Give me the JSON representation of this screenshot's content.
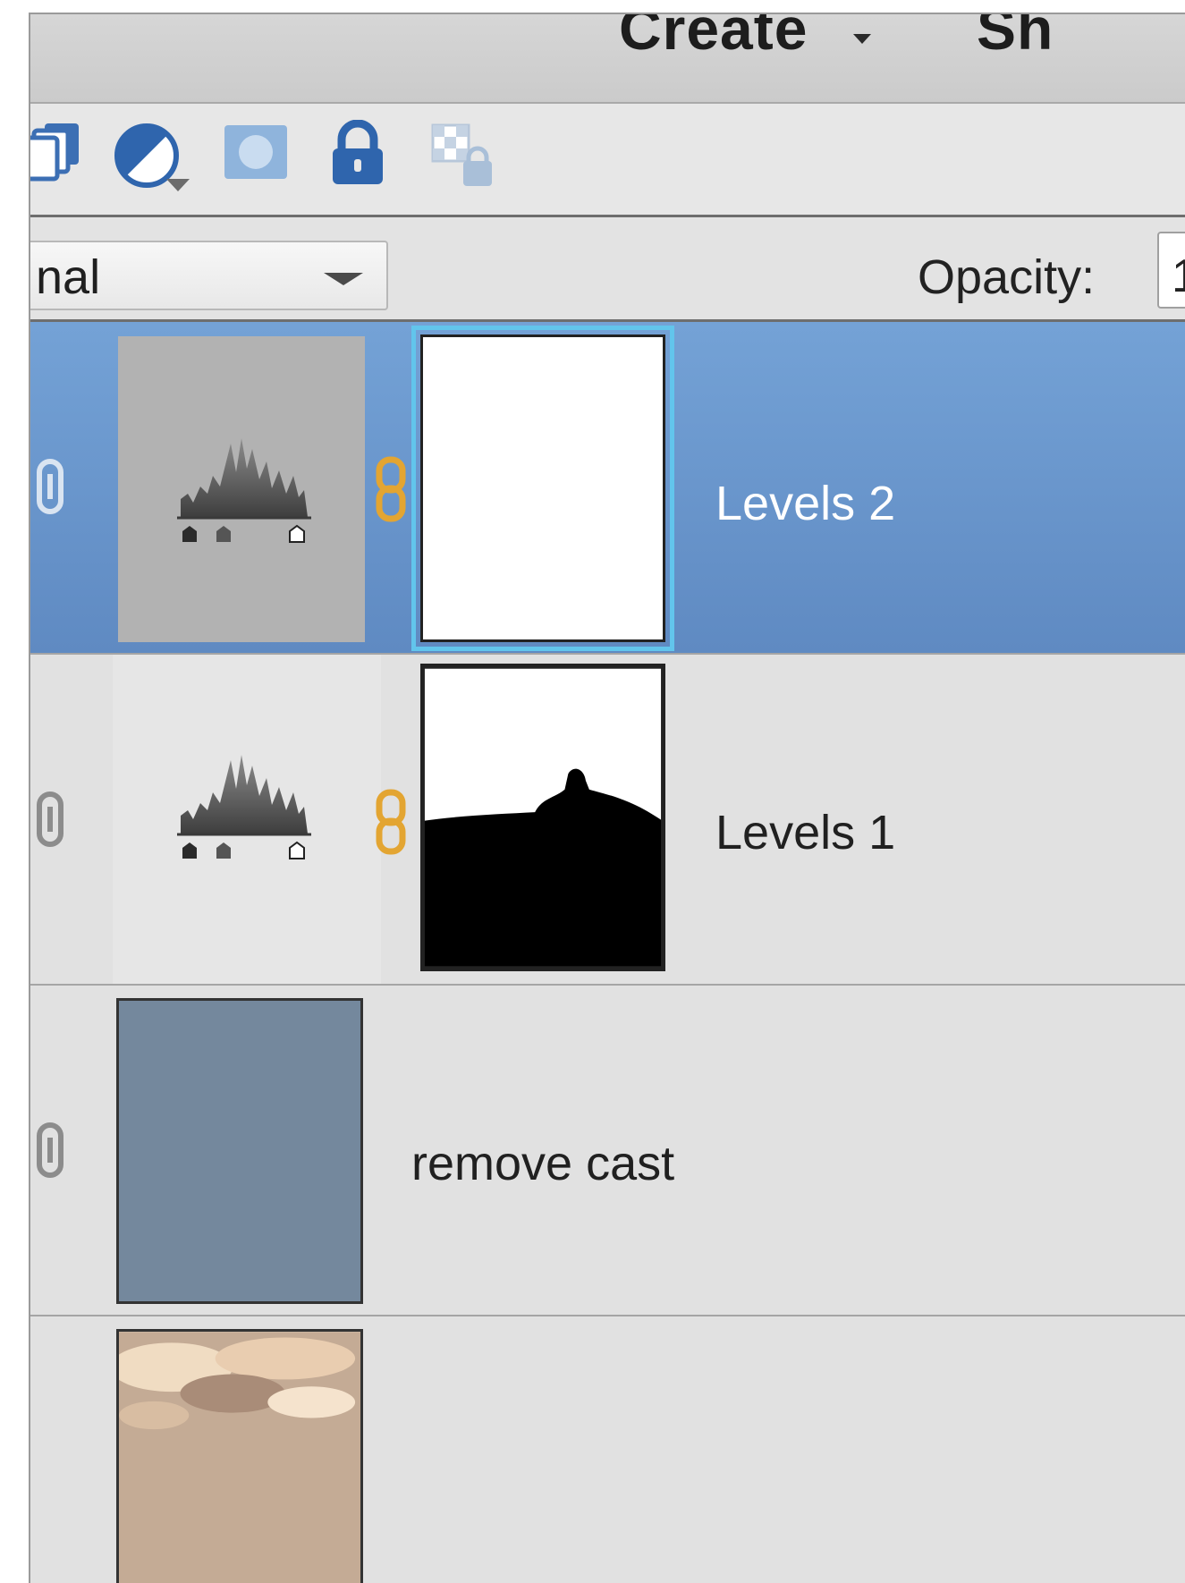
{
  "menubar": {
    "create_label": "Create",
    "share_label": "Sh"
  },
  "toolbar": {
    "icons": [
      "new-layer-group-icon",
      "adjustment-layer-icon",
      "layer-mask-icon",
      "lock-all-icon",
      "lock-transparent-icon"
    ]
  },
  "blend": {
    "mode_value": "nal",
    "opacity_label": "Opacity:",
    "opacity_value": "1"
  },
  "layers": [
    {
      "name": "Levels 2",
      "selected": true,
      "kind": "levels-adjustment",
      "mask": "white"
    },
    {
      "name": "Levels 1",
      "selected": false,
      "kind": "levels-adjustment",
      "mask": "black-bottom-white-top"
    },
    {
      "name": "remove cast",
      "selected": false,
      "kind": "color-fill",
      "fill_color": "#74889d"
    },
    {
      "name": "",
      "selected": false,
      "kind": "photo"
    }
  ],
  "colors": {
    "selection": "#6b98d0",
    "mask_selected_ring": "#62c5ec",
    "link_chain": "#e3a532"
  }
}
